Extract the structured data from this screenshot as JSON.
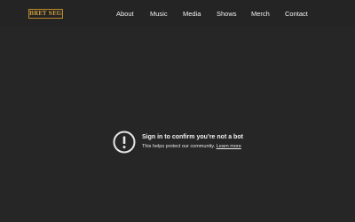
{
  "header": {
    "logo_text": "BRET SEGER",
    "nav": [
      {
        "label": "About"
      },
      {
        "label": "Music"
      },
      {
        "label": "Media"
      },
      {
        "label": "Shows"
      },
      {
        "label": "Merch"
      },
      {
        "label": "Contact"
      }
    ]
  },
  "notice": {
    "icon": "alert-circle-icon",
    "title": "Sign in to confirm you’re not a bot",
    "subtitle": "This helps protect our community.",
    "link_label": "Learn more"
  },
  "colors": {
    "background": "#262626",
    "logo_gold": "#c89a3a",
    "text": "#f2f2f2"
  }
}
